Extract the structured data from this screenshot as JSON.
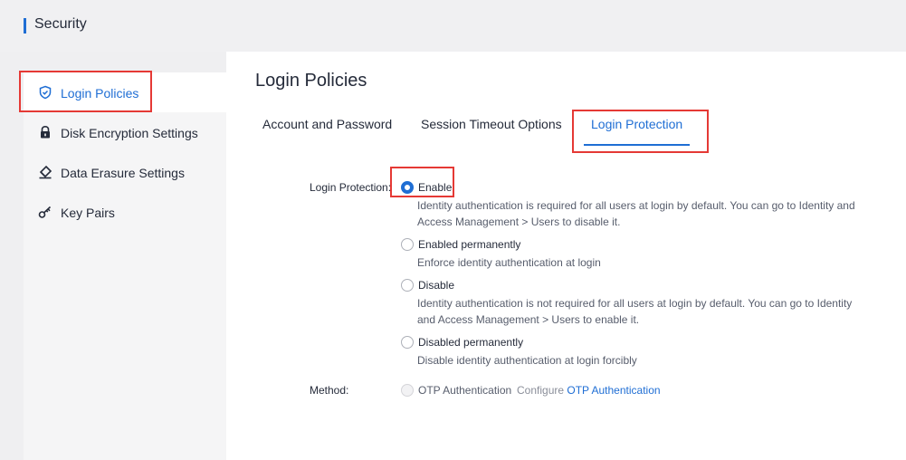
{
  "header": {
    "title": "Security"
  },
  "sidebar": {
    "items": [
      {
        "label": "Login Policies",
        "icon": "shield-icon",
        "active": true
      },
      {
        "label": "Disk Encryption Settings",
        "icon": "lock-icon",
        "active": false
      },
      {
        "label": "Data Erasure Settings",
        "icon": "eraser-icon",
        "active": false
      },
      {
        "label": "Key Pairs",
        "icon": "key-icon",
        "active": false
      }
    ]
  },
  "main": {
    "title": "Login Policies",
    "tabs": [
      {
        "label": "Account and Password"
      },
      {
        "label": "Session Timeout Options"
      },
      {
        "label": "Login Protection",
        "active": true
      }
    ],
    "login_protection": {
      "label": "Login Protection:",
      "options": [
        {
          "label": "Enable",
          "checked": true,
          "description": "Identity authentication is required for all users at login by default. You can go to Identity and Access Management > Users to disable it."
        },
        {
          "label": "Enabled permanently",
          "checked": false,
          "description": "Enforce identity authentication at login"
        },
        {
          "label": "Disable",
          "checked": false,
          "description": "Identity authentication is not required for all users at login by default. You can go to Identity and Access Management > Users to enable it."
        },
        {
          "label": "Disabled permanently",
          "checked": false,
          "description": "Disable identity authentication at login forcibly"
        }
      ]
    },
    "method": {
      "label": "Method:",
      "option_label": "OTP Authentication",
      "configure_text": "Configure",
      "configure_link": "OTP Authentication"
    }
  },
  "colors": {
    "accent": "#1f6ed4",
    "highlight_box": "#e53935"
  }
}
